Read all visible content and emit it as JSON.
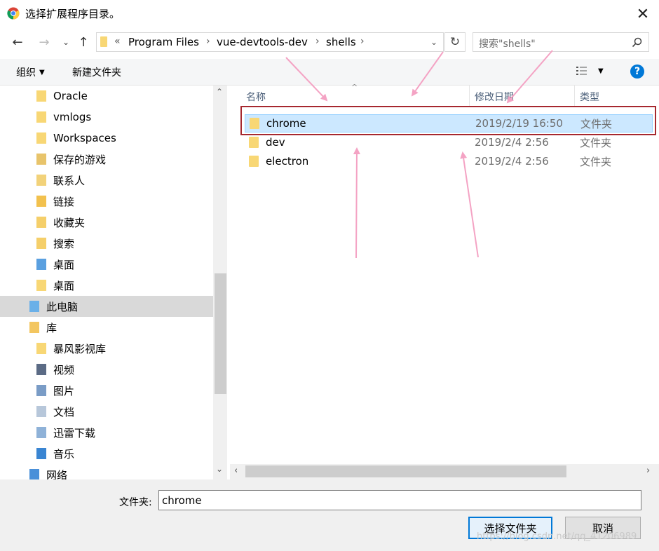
{
  "window": {
    "title": "选择扩展程序目录。"
  },
  "address": {
    "overflow": "«",
    "crumbs": [
      "Program Files",
      "vue-devtools-dev",
      "shells"
    ]
  },
  "search": {
    "placeholder": "搜索\"shells\""
  },
  "toolbar": {
    "organize": "组织",
    "new_folder": "新建文件夹"
  },
  "tree": {
    "items": [
      {
        "label": "Oracle",
        "icon": "folder-icon"
      },
      {
        "label": "vmlogs",
        "icon": "folder-icon"
      },
      {
        "label": "Workspaces",
        "icon": "folder-icon"
      },
      {
        "label": "保存的游戏",
        "icon": "saved-games-icon"
      },
      {
        "label": "联系人",
        "icon": "contacts-icon"
      },
      {
        "label": "链接",
        "icon": "links-icon"
      },
      {
        "label": "收藏夹",
        "icon": "favorites-icon"
      },
      {
        "label": "搜索",
        "icon": "searches-icon"
      },
      {
        "label": "桌面",
        "icon": "desktop-icon"
      },
      {
        "label": "桌面",
        "icon": "folder-icon"
      },
      {
        "label": "此电脑",
        "icon": "computer-icon",
        "selected": true
      },
      {
        "label": "库",
        "icon": "library-icon"
      },
      {
        "label": "暴风影视库",
        "icon": "folder-icon"
      },
      {
        "label": "视频",
        "icon": "videos-icon"
      },
      {
        "label": "图片",
        "icon": "pictures-icon"
      },
      {
        "label": "文档",
        "icon": "documents-icon"
      },
      {
        "label": "迅雷下载",
        "icon": "downloads-icon"
      },
      {
        "label": "音乐",
        "icon": "music-icon"
      },
      {
        "label": "网络",
        "icon": "network-icon"
      }
    ]
  },
  "columns": {
    "name": "名称",
    "modified": "修改日期",
    "type": "类型"
  },
  "files": [
    {
      "name": "chrome",
      "modified": "2019/2/19 16:50",
      "type": "文件夹",
      "selected": true
    },
    {
      "name": "dev",
      "modified": "2019/2/4 2:56",
      "type": "文件夹"
    },
    {
      "name": "electron",
      "modified": "2019/2/4 2:56",
      "type": "文件夹"
    }
  ],
  "bottom": {
    "folder_label": "文件夹:",
    "folder_value": "chrome",
    "select_button": "选择文件夹",
    "cancel_button": "取消"
  },
  "watermark": "https://blog.csdn.net/qq_41206989",
  "colors": {
    "selection": "#cce8ff",
    "annotation_box": "#a6282f",
    "annotation_arrow": "#f4a3c4",
    "accent": "#0078d7"
  }
}
